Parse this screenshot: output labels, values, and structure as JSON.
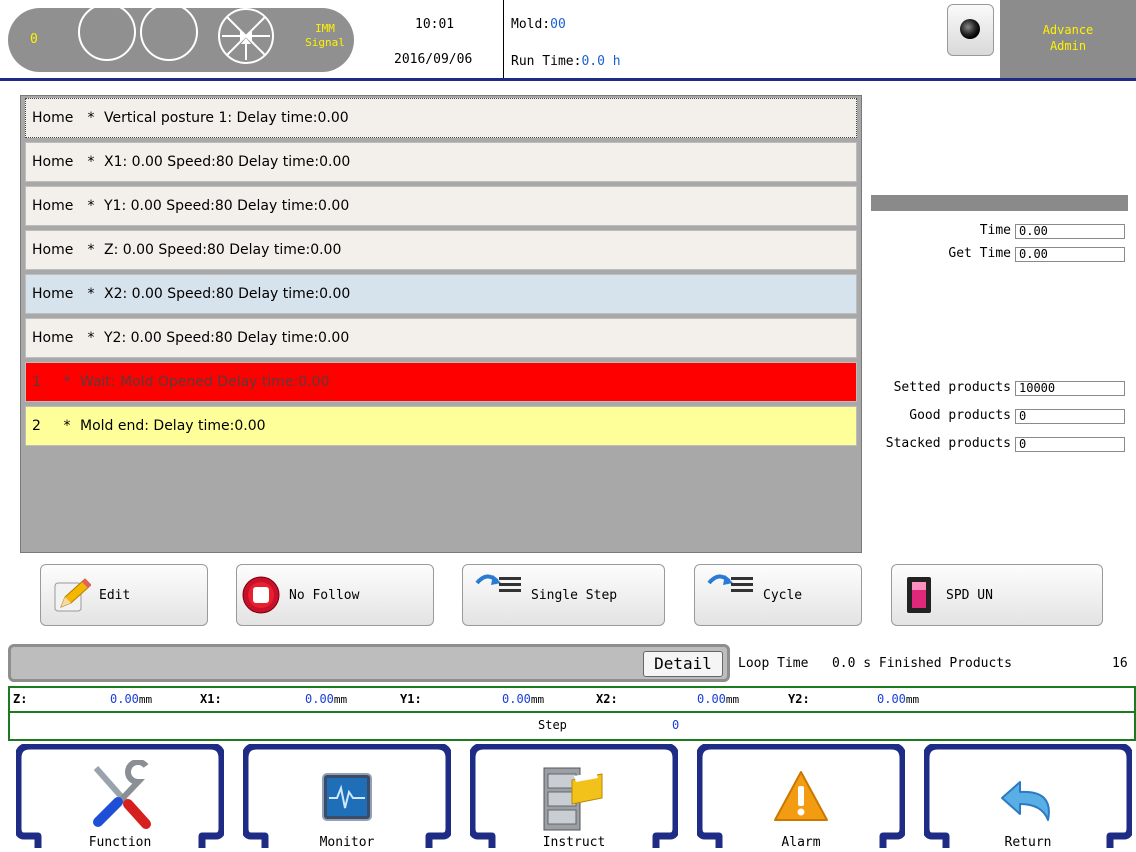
{
  "header": {
    "signal_count": "0",
    "imm_signal_line1": "IMM",
    "imm_signal_line2": "Signal",
    "time": "10:01",
    "date": "2016/09/06",
    "mold_label": "Mold:",
    "mold_value": "00",
    "run_time_label": "Run Time:",
    "run_time_value": "0.0 h",
    "user_level": "Advance",
    "user_name": "Admin"
  },
  "program": {
    "rows": [
      {
        "step": "Home",
        "star": "*",
        "text": "Vertical posture 1:  Delay time:0.00"
      },
      {
        "step": "Home",
        "star": "*",
        "text": "X1: 0.00 Speed:80  Delay time:0.00"
      },
      {
        "step": "Home",
        "star": "*",
        "text": "Y1: 0.00 Speed:80  Delay time:0.00"
      },
      {
        "step": "Home",
        "star": "*",
        "text": "Z: 0.00 Speed:80  Delay time:0.00"
      },
      {
        "step": "Home",
        "star": "*",
        "text": "X2: 0.00 Speed:80  Delay time:0.00"
      },
      {
        "step": "Home",
        "star": "*",
        "text": "Y2: 0.00 Speed:80  Delay time:0.00"
      },
      {
        "step": "1",
        "star": "*",
        "text": "Wait: Mold Opened Delay time:0.00"
      },
      {
        "step": "2",
        "star": "*",
        "text": "Mold end:  Delay time:0.00"
      }
    ]
  },
  "info": {
    "time_label": "Time",
    "time_value": "0.00",
    "get_time_label": "Get Time",
    "get_time_value": "0.00",
    "setted_label": "Setted products",
    "setted_value": "10000",
    "good_label": "Good products",
    "good_value": "0",
    "stacked_label": "Stacked products",
    "stacked_value": "0"
  },
  "actions": {
    "edit": "Edit",
    "no_follow": "No Follow",
    "single_step": "Single Step",
    "cycle": "Cycle",
    "spd": "SPD UN"
  },
  "status": {
    "detail_label": "Detail",
    "loop_time_label": "Loop Time",
    "loop_time_value": "0.0 s",
    "finished_label": "Finished Products",
    "finished_value": "16"
  },
  "axes": {
    "z_label": "Z:",
    "z_value": "0.00",
    "x1_label": "X1:",
    "x1_value": "0.00",
    "y1_label": "Y1:",
    "y1_value": "0.00",
    "x2_label": "X2:",
    "x2_value": "0.00",
    "y2_label": "Y2:",
    "y2_value": "0.00",
    "unit": "mm",
    "step_label": "Step",
    "step_value": "0"
  },
  "nav": {
    "function": "Function",
    "monitor": "Monitor",
    "instruct": "Instruct",
    "alarm": "Alarm",
    "return": "Return"
  },
  "colors": {
    "header_rule": "#1f2c86",
    "signal_text": "#fff200",
    "value_blue": "#1a5fd6",
    "axis_border": "#1e7a1e",
    "row_highlight_red": "#ff0000",
    "row_highlight_yellow": "#ffff99",
    "nav_frame": "#1f2c86"
  }
}
